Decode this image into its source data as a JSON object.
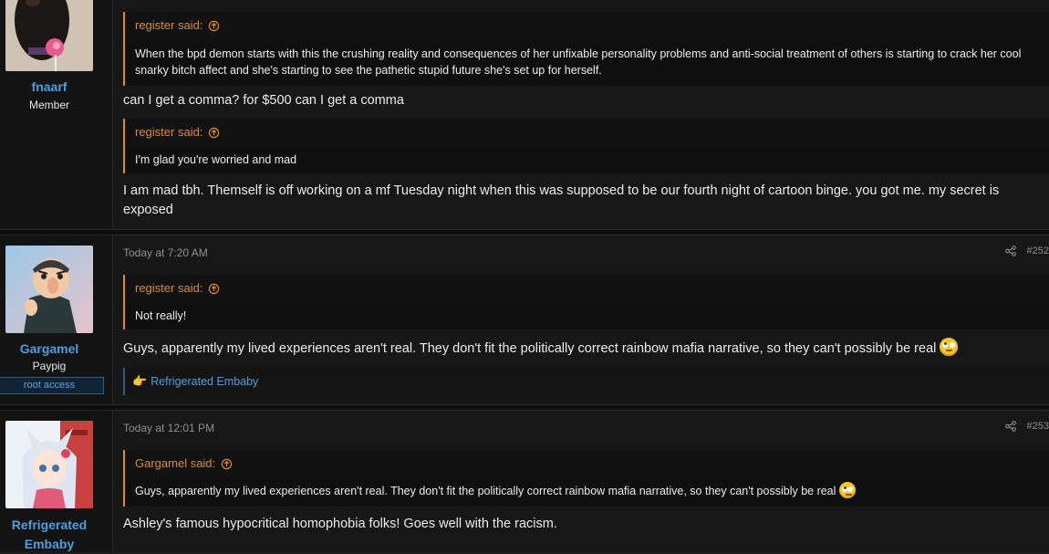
{
  "posts": [
    {
      "username": "fnaarf",
      "user_title": "Member",
      "quotes": [
        {
          "author_line": "register said:",
          "text": "When the bpd demon starts with this the crushing reality and consequences of her unfixable personality problems and anti-social treatment of others is starting to crack her cool snarky bitch affect and she's starting to see the pathetic stupid future she's set up for herself."
        },
        {
          "author_line": "register said:",
          "text": "I'm glad you're worried and mad"
        }
      ],
      "replies": [
        "can I get a comma? for $500 can I get a comma",
        "I am mad tbh. Themself is off working on a mf Tuesday night when this was supposed to be our fourth night of cartoon binge. you got me. my secret is exposed"
      ]
    },
    {
      "username": "Gargamel",
      "user_title": "Paypig",
      "banner": "root access",
      "timestamp": "Today at 7:20 AM",
      "post_number": "#252",
      "quote": {
        "author_line": "register said:",
        "text": "Not really!"
      },
      "message": "Guys, apparently my lived experiences aren't real. They don't fit the politically correct rainbow mafia narrative, so they can't possibly be real",
      "reaction": {
        "emoji": "👉",
        "text": "Refrigerated Embaby"
      }
    },
    {
      "username": "Refrigerated Embaby",
      "timestamp": "Today at 12:01 PM",
      "post_number": "#253",
      "quote": {
        "author_line": "Gargamel said:",
        "text": "Guys, apparently my lived experiences aren't real. They don't fit the politically correct rainbow mafia narrative, so they can't possibly be real"
      },
      "message": "Ashley's famous hypocritical homophobia folks! Goes well with the racism."
    }
  ],
  "icons": {
    "quote_jump": "arrow-up-circle-icon",
    "share": "share-icon",
    "emoji": "rolling-eyes-emoji-icon"
  },
  "colors": {
    "username": "#4a9fe0",
    "quote_accent": "#e08a21",
    "background": "#171717"
  }
}
